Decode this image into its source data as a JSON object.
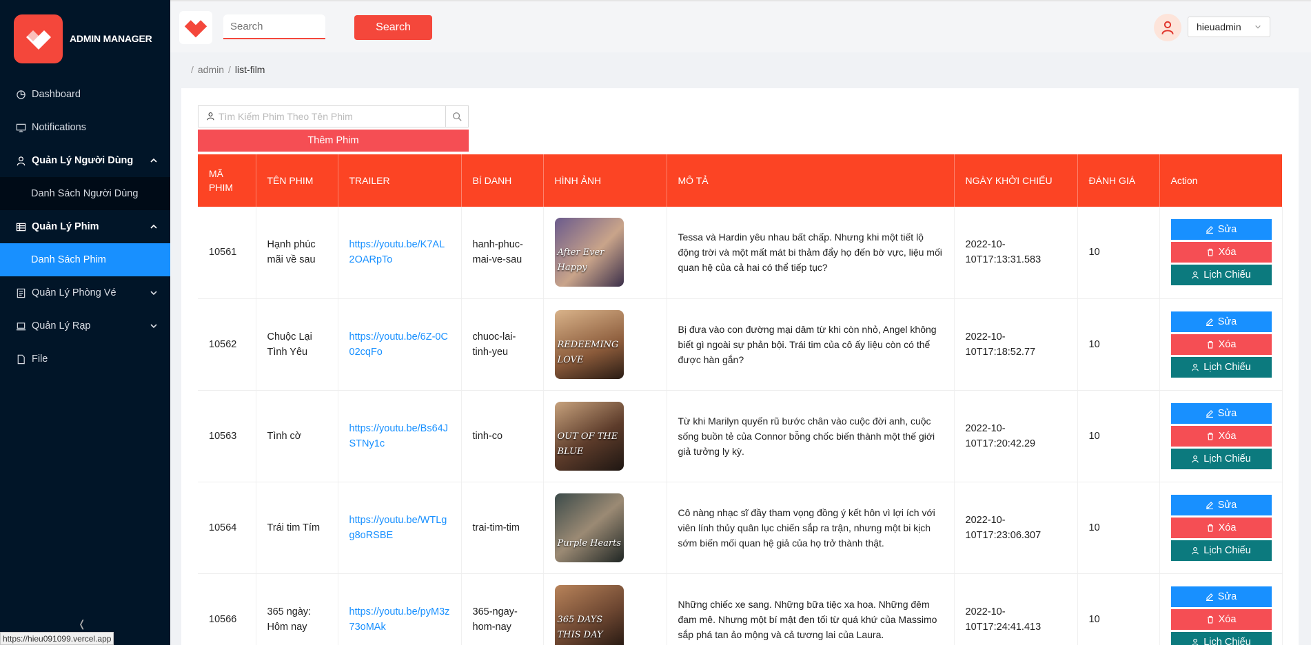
{
  "sidebar": {
    "brand": "ADMIN MANAGER",
    "items": [
      {
        "label": "Dashboard",
        "icon": "pie-chart-icon"
      },
      {
        "label": "Notifications",
        "icon": "desktop-icon"
      },
      {
        "label": "Quản Lý Người Dùng",
        "icon": "user-icon"
      },
      {
        "label": "Danh Sách Người Dùng"
      },
      {
        "label": "Quản Lý Phim",
        "icon": "table-icon"
      },
      {
        "label": "Danh Sách Phim"
      },
      {
        "label": "Quản Lý Phòng Vé",
        "icon": "ticket-icon"
      },
      {
        "label": "Quản Lý Rạp",
        "icon": "laptop-icon"
      },
      {
        "label": "File",
        "icon": "file-icon"
      }
    ]
  },
  "status_url": "https://hieu091099.vercel.app",
  "header": {
    "search_placeholder": "Search",
    "search_button": "Search",
    "username": "hieuadmin"
  },
  "breadcrumb": [
    "admin",
    "list-film"
  ],
  "film_search": {
    "placeholder": "Tìm Kiếm Phim Theo Tên Phim"
  },
  "add_button": "Thêm Phim",
  "table": {
    "headers": [
      "MÃ PHIM",
      "TÊN PHIM",
      "TRAILER",
      "BÍ DANH",
      "HÌNH ẢNH",
      "MÔ TẢ",
      "NGÀY KHỞI CHIẾU",
      "ĐÁNH GIÁ",
      "Action"
    ],
    "actions": {
      "edit": "Sửa",
      "delete": "Xóa",
      "schedule": "Lịch Chiếu"
    },
    "rows": [
      {
        "id": "10561",
        "name": "Hạnh phúc mãi về sau",
        "trailer": "https://youtu.be/K7AL2OARpTo",
        "alias": "hanh-phuc-mai-ve-sau",
        "poster_text": "After Ever Happy",
        "description": "Tessa và Hardin yêu nhau bất chấp. Nhưng khi một tiết lộ động trời và một mất mát bi thảm đẩy họ đến bờ vực, liệu mối quan hệ của cả hai có thể tiếp tục?",
        "date": "2022-10-10T17:13:31.583",
        "rating": "10"
      },
      {
        "id": "10562",
        "name": "Chuộc Lại Tình Yêu",
        "trailer": "https://youtu.be/6Z-0C02cqFo",
        "alias": "chuoc-lai-tinh-yeu",
        "poster_text": "REDEEMING LOVE",
        "description": "Bị đưa vào con đường mại dâm từ khi còn nhỏ, Angel không biết gì ngoài sự phản bội. Trái tim của cô ấy liệu còn có thể được hàn gắn?",
        "date": "2022-10-10T17:18:52.77",
        "rating": "10"
      },
      {
        "id": "10563",
        "name": "Tình cờ",
        "trailer": "https://youtu.be/Bs64JSTNy1c",
        "alias": "tinh-co",
        "poster_text": "OUT OF THE BLUE",
        "description": "Từ khi Marilyn quyến rũ bước chân vào cuộc đời anh, cuộc sống buồn tẻ của Connor bỗng chốc biến thành một thế giới giả tưởng ly kỳ.",
        "date": "2022-10-10T17:20:42.29",
        "rating": "10"
      },
      {
        "id": "10564",
        "name": "Trái tim Tím",
        "trailer": "https://youtu.be/WTLgg8oRSBE",
        "alias": "trai-tim-tim",
        "poster_text": "Purple Hearts",
        "description": "Cô nàng nhạc sĩ đầy tham vọng đồng ý kết hôn vì lợi ích với viên lính thủy quân lục chiến sắp ra trận, nhưng một bi kịch sớm biến mối quan hệ giả của họ trở thành thật.",
        "date": "2022-10-10T17:23:06.307",
        "rating": "10"
      },
      {
        "id": "10566",
        "name": "365 ngày: Hôm nay",
        "trailer": "https://youtu.be/pyM3z73oMAk",
        "alias": "365-ngay-hom-nay",
        "poster_text": "365 DAYS THIS DAY",
        "description": "Những chiếc xe sang. Những bữa tiệc xa hoa. Những đêm đam mê. Nhưng một bí mật đen tối từ quá khứ của Massimo sắp phá tan ảo mộng và cả tương lai của Laura.",
        "date": "2022-10-10T17:24:41.413",
        "rating": "10"
      }
    ]
  }
}
